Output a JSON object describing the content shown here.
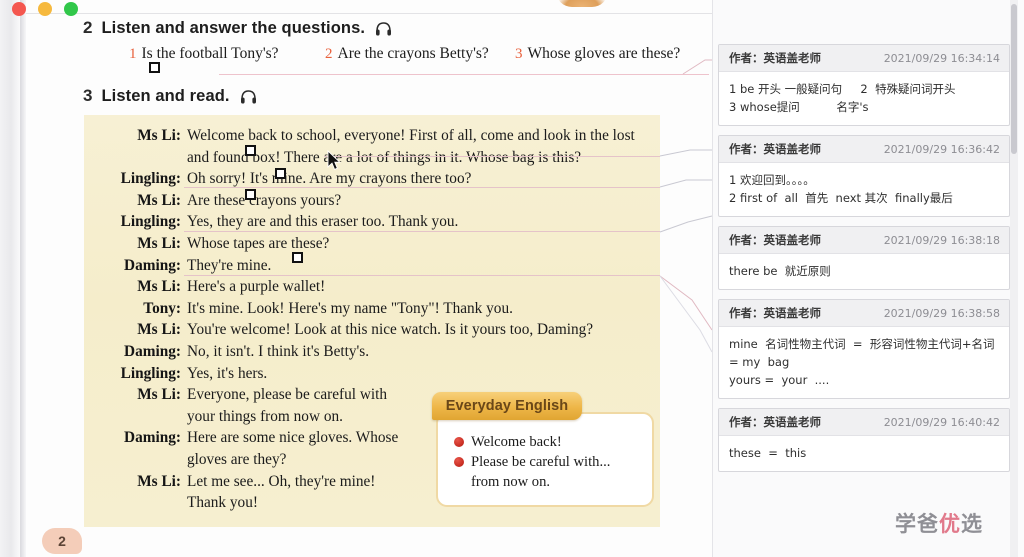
{
  "window": {
    "traffic_lights": [
      "close",
      "minimize",
      "maximize"
    ],
    "colors": {
      "close": "#f4574f",
      "minimize": "#f6b93e",
      "maximize": "#31c74a"
    }
  },
  "book": {
    "page_number": "2",
    "activities": [
      {
        "num": "2",
        "title": "Listen and answer the questions.",
        "icon": "headphone-icon"
      },
      {
        "num": "3",
        "title": "Listen and read.",
        "icon": "headphone-icon"
      }
    ],
    "questions": [
      {
        "num": "1",
        "text": "Is the football Tony's?"
      },
      {
        "num": "2",
        "text": "Are the crayons Betty's?"
      },
      {
        "num": "3",
        "text": "Whose gloves are these?"
      }
    ],
    "dialogue": [
      {
        "speaker": "Ms Li:",
        "line1": "Welcome back to school, everyone! First of all, come and look in the lost",
        "line2": "and found box! There are a lot of things in it. Whose bag is this?"
      },
      {
        "speaker": "Lingling:",
        "line1": "Oh sorry! It's mine. Are my crayons there too?",
        "line2": ""
      },
      {
        "speaker": "Ms Li:",
        "line1": "Are these crayons yours?",
        "line2": ""
      },
      {
        "speaker": "Lingling:",
        "line1": "Yes, they are and this eraser too. Thank you.",
        "line2": ""
      },
      {
        "speaker": "Ms Li:",
        "line1": "Whose tapes are these?",
        "line2": ""
      },
      {
        "speaker": "Daming:",
        "line1": "They're mine.",
        "line2": ""
      },
      {
        "speaker": "Ms Li:",
        "line1": "Here's a purple wallet!",
        "line2": ""
      },
      {
        "speaker": "Tony:",
        "line1": "It's mine. Look! Here's my name \"Tony\"! Thank you.",
        "line2": ""
      },
      {
        "speaker": "Ms Li:",
        "line1": "You're welcome! Look at this nice watch. Is it yours too, Daming?",
        "line2": ""
      },
      {
        "speaker": "Daming:",
        "line1": "No, it isn't. I think it's Betty's.",
        "line2": ""
      },
      {
        "speaker": "Lingling:",
        "line1": "Yes, it's hers.",
        "line2": ""
      },
      {
        "speaker": "Ms Li:",
        "line1": "Everyone, please be careful with",
        "line2": "your things from now on."
      },
      {
        "speaker": "Daming:",
        "line1": "Here are some nice gloves. Whose",
        "line2": "gloves are they?"
      },
      {
        "speaker": "Ms Li:",
        "line1": "Let me see... Oh, they're mine!",
        "line2": "Thank you!"
      }
    ],
    "everyday_english": {
      "tab_label": "Everyday English",
      "items": [
        "Welcome back!",
        "Please be careful with..."
      ],
      "continuation": "from now on."
    }
  },
  "annotations": {
    "author_label": "作者：",
    "cards": [
      {
        "author": "作者：英语盖老师",
        "time": "2021/09/29 16:34:14",
        "lines": [
          "1 be 开头 一般疑问句     2  特殊疑问词开头",
          "3 whose提问          名字's"
        ]
      },
      {
        "author": "作者：英语盖老师",
        "time": "2021/09/29 16:36:42",
        "lines": [
          "1 欢迎回到。。。。",
          "2 first of  all  首先  next 其次  finally最后"
        ]
      },
      {
        "author": "作者：英语盖老师",
        "time": "2021/09/29 16:38:18",
        "lines": [
          "there be  就近原则"
        ]
      },
      {
        "author": "作者：英语盖老师",
        "time": "2021/09/29 16:38:58",
        "lines": [
          "mine  名词性物主代词  =  形容词性物主代词+名词",
          "= my  bag",
          "yours =  your  ...."
        ]
      },
      {
        "author": "作者：英语盖老师",
        "time": "2021/09/29 16:40:42",
        "lines": [
          "these  =  this"
        ]
      }
    ]
  },
  "watermark": {
    "text_grey_1": "学爸",
    "text_red": "优",
    "text_grey_2": "选"
  },
  "colors": {
    "dialogue_bg": "#f5edcb",
    "question_num": "#e8603c",
    "underline": "#eec3cc",
    "page_badge": "#f4cdb9",
    "ee_tab": "#eeb648",
    "watermark_red": "#e1798b"
  }
}
